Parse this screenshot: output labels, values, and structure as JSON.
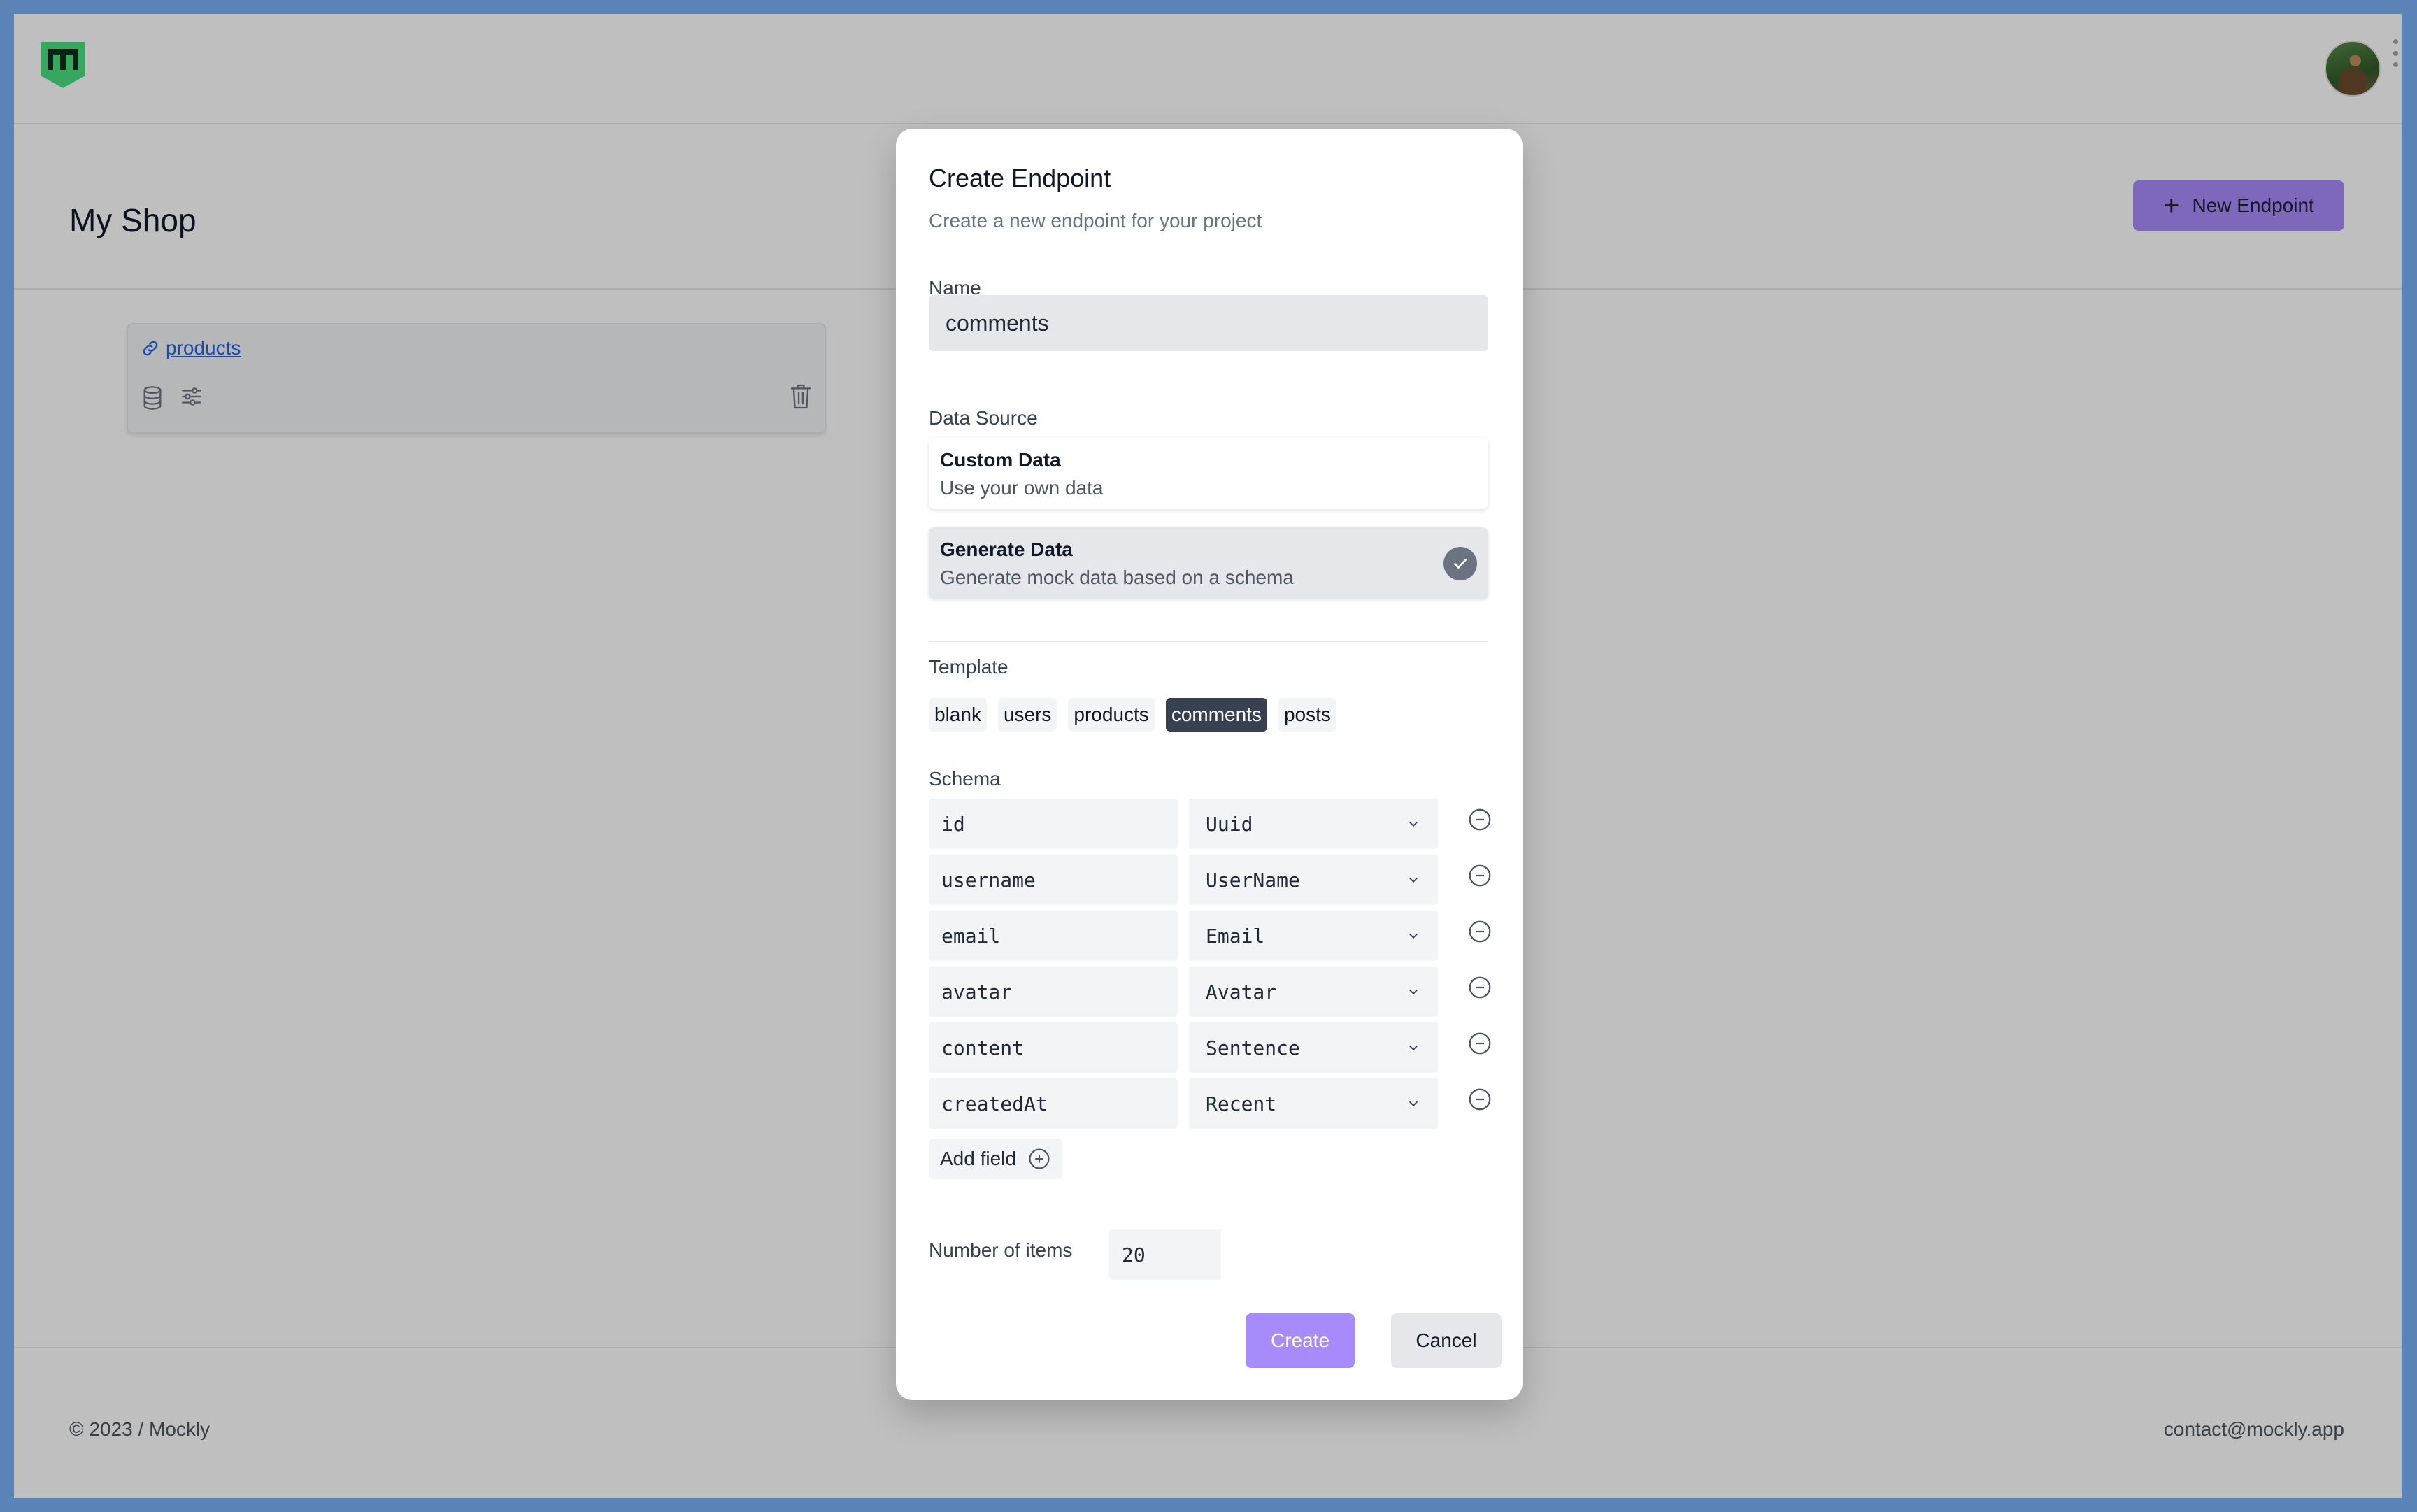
{
  "page": {
    "title": "My Shop",
    "new_endpoint_label": "New Endpoint",
    "footer_left": "© 2023 / Mockly",
    "footer_right": "contact@mockly.app"
  },
  "endpoints": [
    {
      "name": "products"
    }
  ],
  "modal": {
    "title": "Create Endpoint",
    "subtitle": "Create a new endpoint for your project",
    "name_label": "Name",
    "name_value": "comments",
    "data_source_label": "Data Source",
    "data_sources": [
      {
        "title": "Custom Data",
        "description": "Use your own data",
        "selected": false
      },
      {
        "title": "Generate Data",
        "description": "Generate mock data based on a schema",
        "selected": true
      }
    ],
    "template_label": "Template",
    "templates": [
      {
        "label": "blank",
        "active": false
      },
      {
        "label": "users",
        "active": false
      },
      {
        "label": "products",
        "active": false
      },
      {
        "label": "comments",
        "active": true
      },
      {
        "label": "posts",
        "active": false
      }
    ],
    "schema_label": "Schema",
    "schema": [
      {
        "field": "id",
        "type": "Uuid"
      },
      {
        "field": "username",
        "type": "UserName"
      },
      {
        "field": "email",
        "type": "Email"
      },
      {
        "field": "avatar",
        "type": "Avatar"
      },
      {
        "field": "content",
        "type": "Sentence"
      },
      {
        "field": "createdAt",
        "type": "Recent"
      }
    ],
    "add_field_label": "Add field",
    "items_label": "Number of items",
    "items_value": "20",
    "create_label": "Create",
    "cancel_label": "Cancel"
  },
  "colors": {
    "accent": "#a78bfa",
    "logo": "#4ade80",
    "link": "#2563eb",
    "active_chip": "#374151"
  }
}
